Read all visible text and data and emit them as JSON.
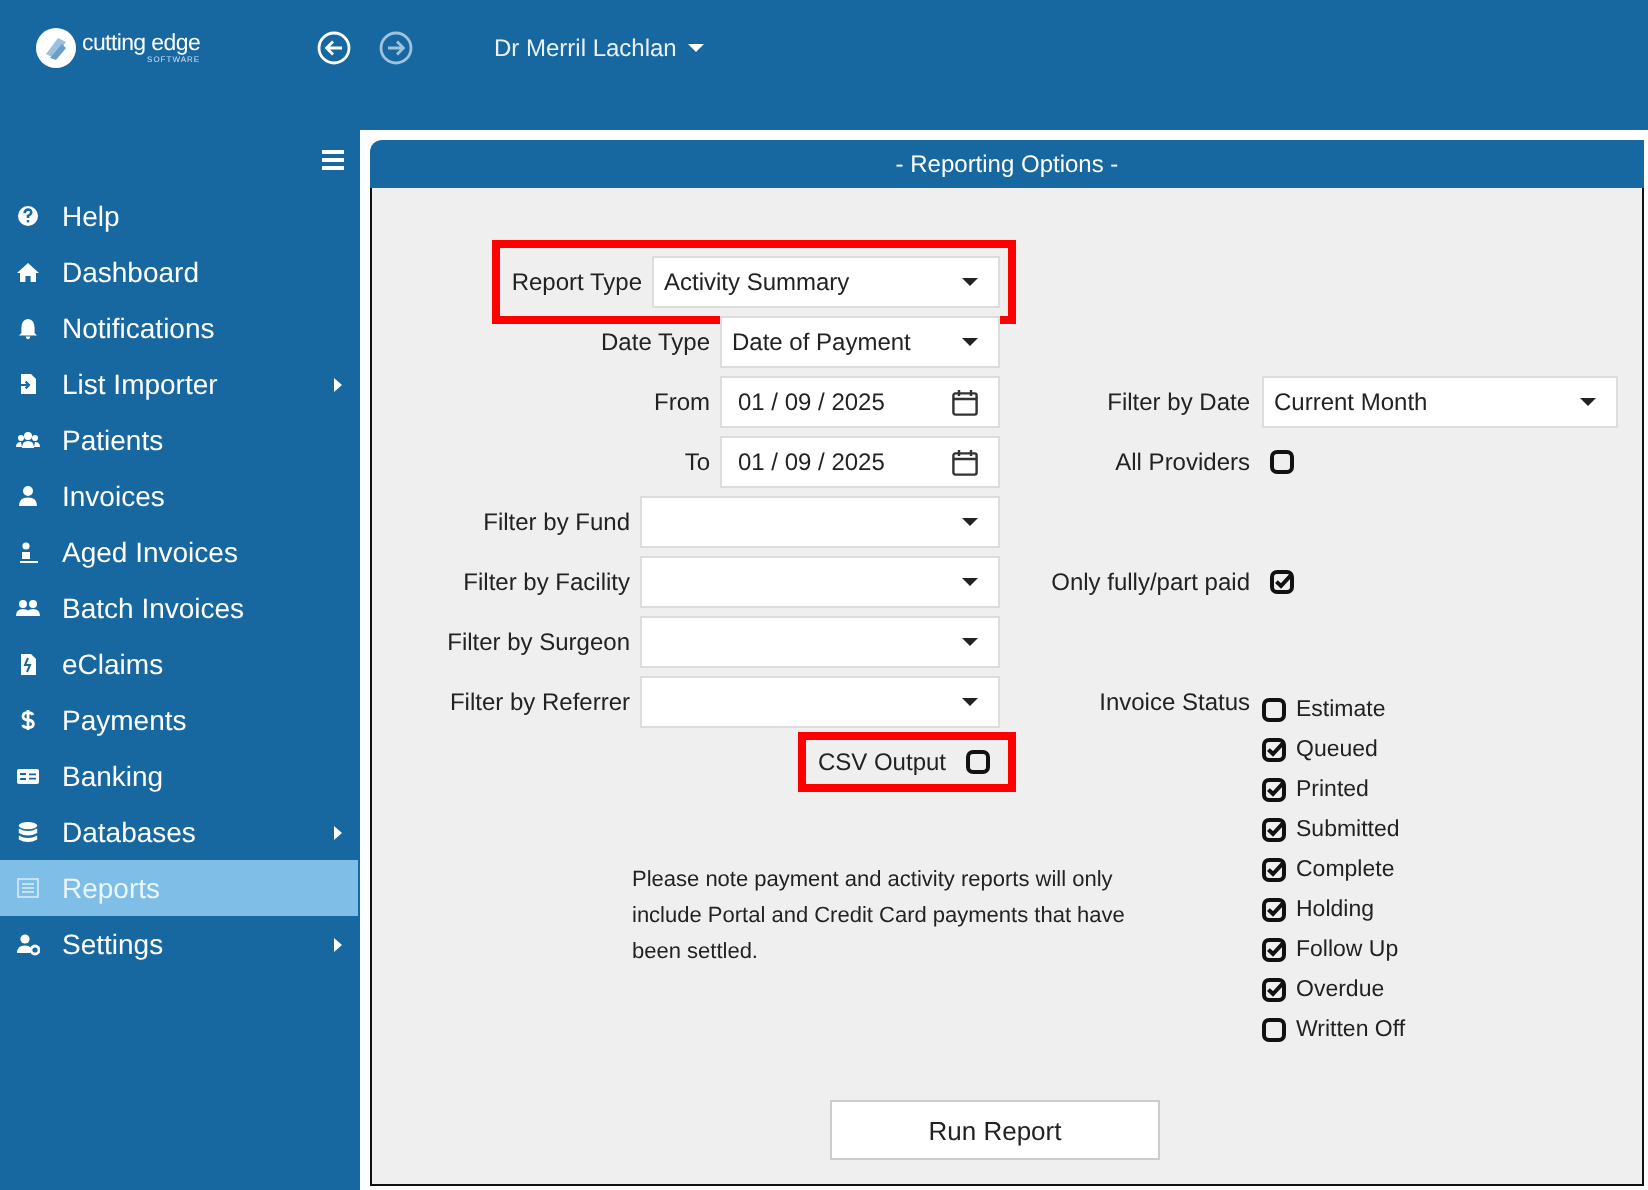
{
  "header": {
    "logo_text": "cutting edge",
    "logo_subtext": "SOFTWARE",
    "user": "Dr Merril Lachlan"
  },
  "sidebar": {
    "items": [
      {
        "label": "Help",
        "has_submenu": false,
        "selected": false
      },
      {
        "label": "Dashboard",
        "has_submenu": false,
        "selected": false
      },
      {
        "label": "Notifications",
        "has_submenu": false,
        "selected": false
      },
      {
        "label": "List Importer",
        "has_submenu": true,
        "selected": false
      },
      {
        "label": "Patients",
        "has_submenu": false,
        "selected": false
      },
      {
        "label": "Invoices",
        "has_submenu": false,
        "selected": false
      },
      {
        "label": "Aged Invoices",
        "has_submenu": false,
        "selected": false
      },
      {
        "label": "Batch Invoices",
        "has_submenu": false,
        "selected": false
      },
      {
        "label": "eClaims",
        "has_submenu": false,
        "selected": false
      },
      {
        "label": "Payments",
        "has_submenu": false,
        "selected": false
      },
      {
        "label": "Banking",
        "has_submenu": false,
        "selected": false
      },
      {
        "label": "Databases",
        "has_submenu": true,
        "selected": false
      },
      {
        "label": "Reports",
        "has_submenu": false,
        "selected": true
      },
      {
        "label": "Settings",
        "has_submenu": true,
        "selected": false
      }
    ]
  },
  "panel": {
    "title": "- Reporting Options -",
    "left_fields": [
      {
        "kind": "select",
        "label": "Report Type",
        "value": "Activity Summary",
        "highlighted": true
      },
      {
        "kind": "select",
        "label": "Date Type",
        "value": "Date of Payment",
        "highlighted": false
      },
      {
        "kind": "date",
        "label": "From",
        "value": "01 / 09 / 2025",
        "highlighted": false
      },
      {
        "kind": "date",
        "label": "To",
        "value": "01 / 09 / 2025",
        "highlighted": false
      },
      {
        "kind": "select",
        "label": "Filter by Fund",
        "highlighted": false
      },
      {
        "kind": "select",
        "label": "Filter by Facility",
        "highlighted": false
      },
      {
        "kind": "select",
        "label": "Filter by Surgeon",
        "highlighted": false
      },
      {
        "kind": "select",
        "label": "Filter by Referrer",
        "highlighted": false
      },
      {
        "kind": "checkbox",
        "label": "CSV Output",
        "checked": false,
        "highlighted": true
      }
    ],
    "right_fields": [
      {
        "kind": "select",
        "label": "Filter by Date",
        "value": "Current Month"
      },
      {
        "kind": "checkbox",
        "label": "All Providers",
        "checked": false
      },
      {
        "kind": "checkbox",
        "label": "Only fully/part paid",
        "checked": true
      },
      {
        "kind": "checklist",
        "label": "Invoice Status",
        "options": [
          {
            "label": "Estimate",
            "checked": false
          },
          {
            "label": "Queued",
            "checked": true
          },
          {
            "label": "Printed",
            "checked": true
          },
          {
            "label": "Submitted",
            "checked": true
          },
          {
            "label": "Complete",
            "checked": true
          },
          {
            "label": "Holding",
            "checked": true
          },
          {
            "label": "Follow Up",
            "checked": true
          },
          {
            "label": "Overdue",
            "checked": true
          },
          {
            "label": "Written Off",
            "checked": false
          }
        ]
      }
    ],
    "note": "Please note payment and activity reports will only include Portal and Credit Card payments that have been settled.",
    "run_button": "Run Report"
  }
}
